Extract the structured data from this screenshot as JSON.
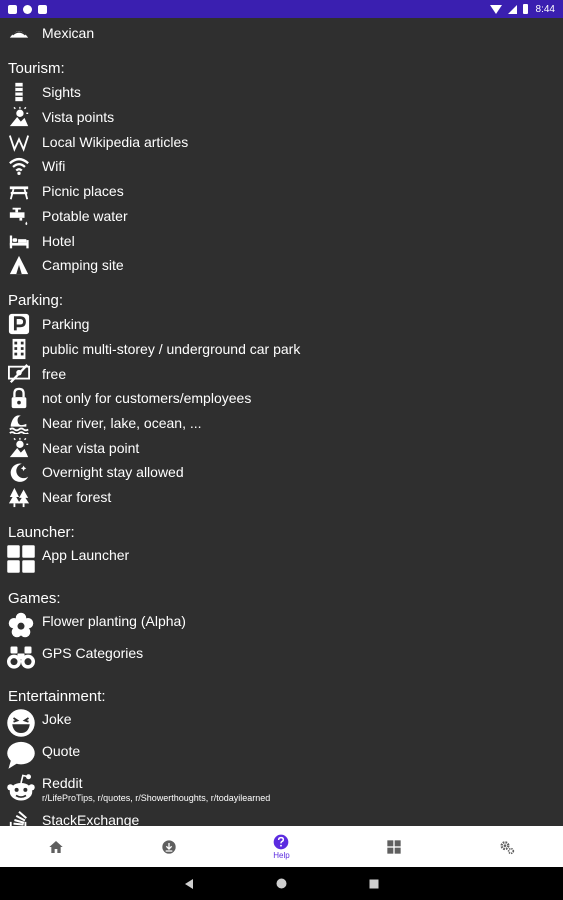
{
  "status_bar": {
    "time": "8:44"
  },
  "top_item": {
    "label": "Mexican",
    "icon": "taco-icon"
  },
  "sections": {
    "tourism": {
      "title": "Tourism:",
      "items": [
        {
          "label": "Sights",
          "icon": "tower-icon"
        },
        {
          "label": "Vista points",
          "icon": "vista-icon"
        },
        {
          "label": "Local Wikipedia articles",
          "icon": "wikipedia-icon"
        },
        {
          "label": "Wifi",
          "icon": "wifi-icon"
        },
        {
          "label": "Picnic places",
          "icon": "picnic-icon"
        },
        {
          "label": "Potable water",
          "icon": "water-tap-icon"
        },
        {
          "label": "Hotel",
          "icon": "bed-icon"
        },
        {
          "label": "Camping site",
          "icon": "tent-icon"
        }
      ]
    },
    "parking": {
      "title": "Parking:",
      "items": [
        {
          "label": "Parking",
          "icon": "parking-icon"
        },
        {
          "label": "public multi-storey / underground car park",
          "icon": "building-icon"
        },
        {
          "label": "free",
          "icon": "free-icon"
        },
        {
          "label": "not only for customers/employees",
          "icon": "lock-icon"
        },
        {
          "label": "Near river, lake, ocean, ...",
          "icon": "waves-icon"
        },
        {
          "label": "Near vista point",
          "icon": "vista-icon"
        },
        {
          "label": "Overnight stay allowed",
          "icon": "moon-icon"
        },
        {
          "label": "Near forest",
          "icon": "trees-icon"
        }
      ]
    },
    "launcher": {
      "title": "Launcher:",
      "items": [
        {
          "label": "App Launcher",
          "icon": "grid-icon"
        }
      ]
    },
    "games": {
      "title": "Games:",
      "items": [
        {
          "label": "Flower planting (Alpha)",
          "icon": "flower-icon"
        },
        {
          "label": "GPS Categories",
          "icon": "binoculars-icon"
        }
      ]
    },
    "entertainment": {
      "title": "Entertainment:",
      "items": [
        {
          "label": "Joke",
          "icon": "laugh-icon"
        },
        {
          "label": "Quote",
          "icon": "speech-bubble-icon"
        },
        {
          "label": "Reddit",
          "sub": "r/LifeProTips, r/quotes, r/Showerthoughts, r/todayilearned",
          "icon": "reddit-icon"
        },
        {
          "label": "StackExchange",
          "icon": "stackexchange-icon"
        }
      ]
    }
  },
  "bottom_nav": {
    "items": [
      {
        "name": "home",
        "label": "",
        "icon": "home-icon"
      },
      {
        "name": "download",
        "label": "",
        "icon": "download-icon"
      },
      {
        "name": "help",
        "label": "Help",
        "icon": "help-icon"
      },
      {
        "name": "apps",
        "label": "",
        "icon": "grid-icon"
      },
      {
        "name": "settings",
        "label": "",
        "icon": "settings-icon"
      }
    ]
  },
  "colors": {
    "status_bar": "#3a1fb0",
    "background": "#2f2f2f",
    "accent": "#5b2be0"
  }
}
